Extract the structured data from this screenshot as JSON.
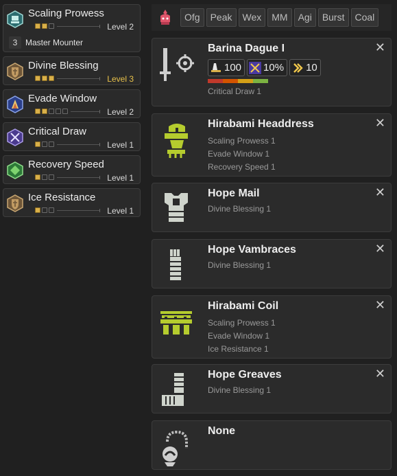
{
  "skills": [
    {
      "name": "Scaling Prowess",
      "level": "Level 2",
      "icon": "scaling-prowess-icon",
      "filled": 2,
      "max": 3,
      "set_count": "3",
      "set_name": "Master Mounter"
    },
    {
      "name": "Divine Blessing",
      "level": "Level 3",
      "icon": "divine-blessing-icon",
      "filled": 3,
      "max": 3,
      "maxed": true
    },
    {
      "name": "Evade Window",
      "level": "Level 2",
      "icon": "evade-window-icon",
      "filled": 2,
      "max": 5
    },
    {
      "name": "Critical Draw",
      "level": "Level 1",
      "icon": "critical-draw-icon",
      "filled": 1,
      "max": 3
    },
    {
      "name": "Recovery Speed",
      "level": "Level 1",
      "icon": "recovery-speed-icon",
      "filled": 1,
      "max": 3
    },
    {
      "name": "Ice Resistance",
      "level": "Level 1",
      "icon": "ice-resistance-icon",
      "filled": 1,
      "max": 3
    }
  ],
  "filters": {
    "icon": "monster-filter-icon",
    "chips": [
      "Ofg",
      "Peak",
      "Wex",
      "MM",
      "Agi",
      "Burst",
      "Coal"
    ]
  },
  "equipment": {
    "weapon": {
      "name": "Barina Dague I",
      "icon": "great-sword-icon",
      "attack": "100",
      "affinity": "10%",
      "element": "10",
      "sharpness": [
        "#c0392b",
        "#d35400",
        "#d4a017",
        "#7cb342"
      ],
      "skills": [
        "Critical Draw 1"
      ]
    },
    "head": {
      "name": "Hirabami Headdress",
      "icon": "helmet-icon",
      "skills": [
        "Scaling Prowess 1",
        "Evade Window 1",
        "Recovery Speed 1"
      ]
    },
    "chest": {
      "name": "Hope Mail",
      "icon": "chest-armor-icon",
      "skills": [
        "Divine Blessing 1"
      ]
    },
    "arms": {
      "name": "Hope Vambraces",
      "icon": "arm-armor-icon",
      "skills": [
        "Divine Blessing 1"
      ]
    },
    "waist": {
      "name": "Hirabami Coil",
      "icon": "waist-armor-icon",
      "skills": [
        "Scaling Prowess 1",
        "Evade Window 1",
        "Ice Resistance 1"
      ]
    },
    "legs": {
      "name": "Hope Greaves",
      "icon": "leg-armor-icon",
      "skills": [
        "Divine Blessing 1"
      ]
    },
    "charm": {
      "name": "None",
      "icon": "charm-icon"
    }
  },
  "colors": {
    "accent_gold": "#e8c14a",
    "rarity_green": "#b5cc2e",
    "armor_gray": "#cfd4cc",
    "ice_blue": "#3a6fd8",
    "crit_purple": "#6b4fd6",
    "recovery_green": "#3fa84a"
  }
}
